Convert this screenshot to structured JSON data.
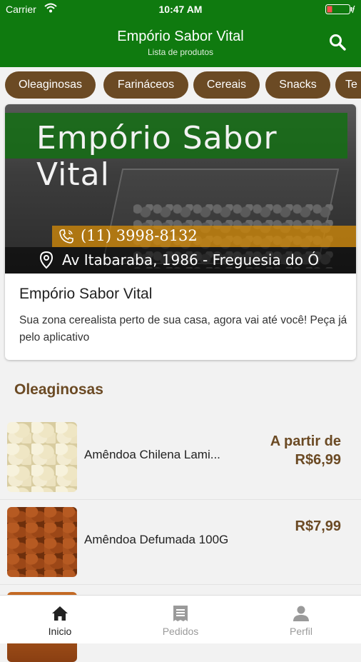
{
  "status_bar": {
    "carrier": "Carrier",
    "time": "10:47 AM"
  },
  "app_bar": {
    "title": "Empório Sabor Vital",
    "subtitle": "Lista de produtos"
  },
  "categories": [
    "Oleaginosas",
    "Farináceos",
    "Cereais",
    "Snacks",
    "Te"
  ],
  "store_card": {
    "banner_title": "Empório Sabor Vital",
    "phone": "(11) 3998-8132",
    "address": "Av Itabaraba, 1986 - Freguesia do Ó",
    "name": "Empório Sabor Vital",
    "description": "Sua zona cerealista perto de sua casa, agora vai até você! Peça já pelo aplicativo"
  },
  "section": {
    "title": "Oleaginosas"
  },
  "products": [
    {
      "name": "Amêndoa Chilena Lami...",
      "price_prefix": "A partir de",
      "price": "R$6,99"
    },
    {
      "name": "Amêndoa Defumada 100G",
      "price_prefix": "",
      "price": "R$7,99"
    }
  ],
  "bottom_nav": [
    {
      "label": "Inicio",
      "icon": "home-icon",
      "active": true
    },
    {
      "label": "Pedidos",
      "icon": "receipt-icon",
      "active": false
    },
    {
      "label": "Perfil",
      "icon": "person-icon",
      "active": false
    }
  ],
  "colors": {
    "primary": "#0f7a0f",
    "accent": "#6b4a24",
    "inactive": "#9a9a9a",
    "active": "#222222"
  }
}
